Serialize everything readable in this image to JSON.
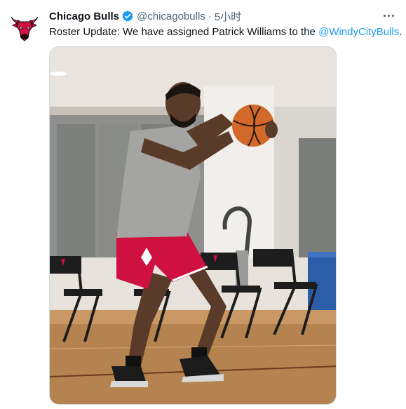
{
  "tweet": {
    "author_name": "Chicago Bulls",
    "author_handle": "@chicagobulls",
    "separator": "·",
    "timestamp": "5小时",
    "text_prefix": "Roster Update: We have assigned Patrick Williams to the ",
    "mention": "@WindyCityBulls",
    "text_suffix": ".",
    "verified": true,
    "media": {
      "icon": "photo-basketball-player-shooting",
      "alt_description": ""
    }
  },
  "colors": {
    "link": "#1d9bf0",
    "secondary_text": "#536471",
    "verified_badge": "#1d9bf0",
    "bulls_red": "#ce1141"
  },
  "icons": {
    "avatar": "chicago-bulls-logo-icon",
    "verified": "verified-badge-icon",
    "more": "more-options-icon"
  }
}
